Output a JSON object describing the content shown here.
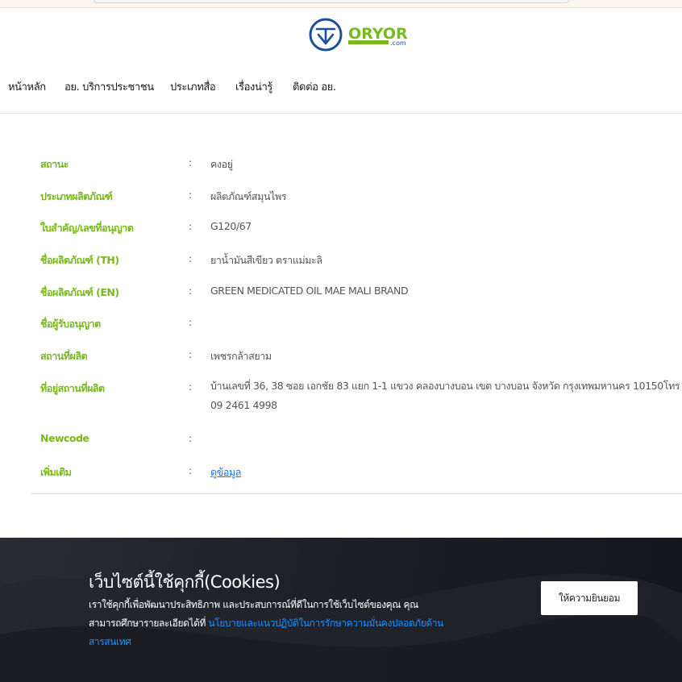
{
  "brand": {
    "logo_text": "ORYOR",
    "logo_suffix": ".com",
    "colors": {
      "blue": "#1c4f9c",
      "green": "#78b91e"
    }
  },
  "nav": {
    "items": [
      {
        "label": "หน้าหลัก"
      },
      {
        "label": "อย. บริการประชาชน"
      },
      {
        "label": "ประเภทสื่อ"
      },
      {
        "label": "เรื่องน่ารู้"
      },
      {
        "label": "ติดต่อ อย."
      }
    ]
  },
  "details": {
    "rows": [
      {
        "label": "สถานะ",
        "value": "คงอยู่"
      },
      {
        "label": "ประเภทผลิตภัณฑ์",
        "value": "ผลิตภัณฑ์สมุนไพร"
      },
      {
        "label": "ใบสำคัญ/เลขที่อนุญาต",
        "value": "G120/67"
      },
      {
        "label": "ชื่อผลิตภัณฑ์ (TH)",
        "value": "ยาน้ำมันสีเขียว ตราแม่มะลิ"
      },
      {
        "label": "ชื่อผลิตภัณฑ์ (EN)",
        "value": "GREEN MEDICATED OIL MAE MALI BRAND"
      },
      {
        "label": "ชื่อผู้รับอนุญาต",
        "value": ""
      },
      {
        "label": "สถานที่ผลิต",
        "value": "เพชรกล้าสยาม"
      },
      {
        "label": "ที่อยู่สถานที่ผลิต",
        "value": "บ้านเลขที่ 36, 38 ซอย เอกชัย 83 แยก 1-1 แขวง คลองบางบอน เขต บางบอน จังหวัด กรุงเทพมหานคร 10150โทร 09 2461 4998"
      },
      {
        "label": "Newcode",
        "value": ""
      },
      {
        "label": "เพิ่มเติม",
        "value": "ดูข้อมูล"
      }
    ],
    "colon": ":"
  },
  "cookie": {
    "title": "เว็บไซต์นี้ใช้คุกกี้(Cookies)",
    "text": "เราใช้คุกกี้เพื่อพัฒนาประสิทธิภาพ และประสบการณ์ที่ดีในการใช้เว็บไซต์ของคุณ คุณสามารถศึกษารายละเอียดได้ที่ ",
    "link": "นโยบายและแนวปฏิบัติในการรักษาความมั่นคงปลอดภัยด้านสารสนเทศ",
    "accept_label": "ให้ความยินยอม"
  }
}
